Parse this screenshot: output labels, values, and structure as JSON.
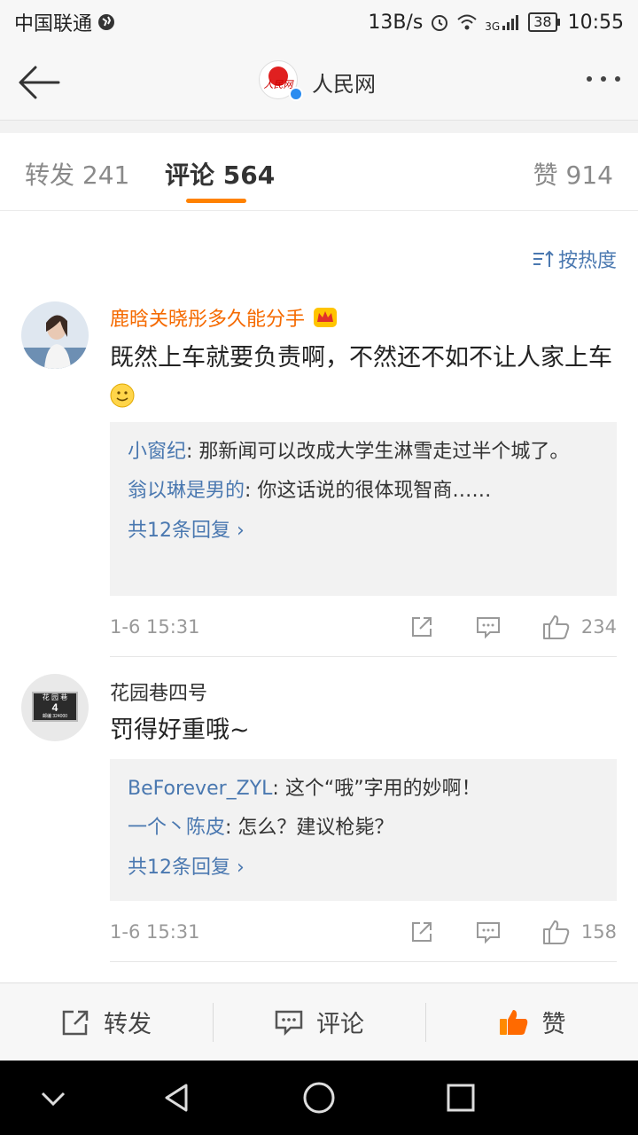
{
  "status_bar": {
    "carrier": "中国联通",
    "network_speed": "13B/s",
    "signal_type": "3G",
    "battery": "38",
    "time": "10:55"
  },
  "nav": {
    "title": "人民网",
    "logo_text": "人民网",
    "logo_subtext": "people"
  },
  "tabs": [
    {
      "label": "转发 241"
    },
    {
      "label": "评论 564"
    },
    {
      "label": "赞 914"
    }
  ],
  "sort": {
    "label": "按热度"
  },
  "comments": [
    {
      "author": "鹿晗关晓彤多久能分手",
      "content": "既然上车就要负责啊，不然还不如不让人家上车",
      "replies": [
        {
          "name": "小窗纪",
          "text": ": 那新闻可以改成大学生淋雪走过半个城了。"
        },
        {
          "name": "翁以琳是男的",
          "text": ": 你这话说的很体现智商……"
        }
      ],
      "more_replies": "共12条回复 ›",
      "time": "1-6 15:31",
      "likes": "234"
    },
    {
      "author": "花园巷四号",
      "avatar_text": "花 园 巷",
      "avatar_number": "4",
      "avatar_code": "邮编 324000",
      "content": "罚得好重哦~",
      "replies": [
        {
          "name": "BeForever_ZYL",
          "text": ": 这个“哦”字用的妙啊！"
        },
        {
          "name": "一个丶陈皮",
          "text": ": 怎么？建议枪毙？"
        }
      ],
      "more_replies": "共12条回复 ›",
      "time": "1-6 15:31",
      "likes": "158"
    }
  ],
  "bottom_bar": {
    "repost": "转发",
    "comment": "评论",
    "like": "赞"
  },
  "colors": {
    "accent": "#ff8200",
    "link": "#4a78b0",
    "vip_name": "#f56a00"
  }
}
